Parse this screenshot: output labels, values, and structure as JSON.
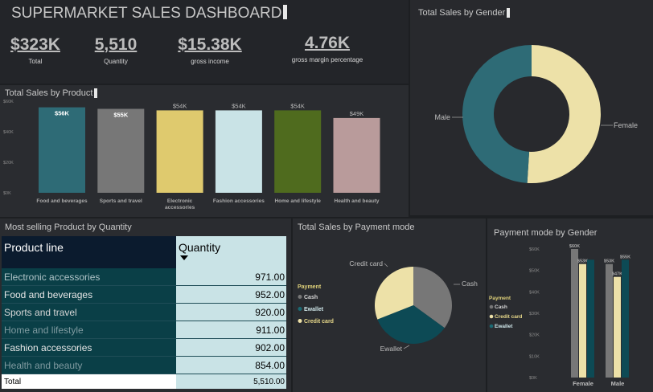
{
  "header": {
    "title": "SUPERMARKET SALES DASHBOARD"
  },
  "kpis": [
    {
      "value": "$323K",
      "label": "Total"
    },
    {
      "value": "5,510",
      "label": "Quantity"
    },
    {
      "value": "$15.38K",
      "label": "gross income"
    },
    {
      "value": "4.76K",
      "label": "gross margin percentage"
    }
  ],
  "colors": {
    "teal_dark": "#0d4a55",
    "teal": "#2e6b76",
    "cream": "#ede1a8",
    "grey": "#777777",
    "yellow": "#dfca6e",
    "light_blue": "#c9e3e6",
    "olive": "#4f6b1e",
    "rose": "#b99b9b"
  },
  "product_chart": {
    "title": "Total Sales by Product",
    "y_ticks": [
      "$0K",
      "$20K",
      "$40K",
      "$60K"
    ]
  },
  "gender_chart": {
    "title": "Total Sales by Gender"
  },
  "table": {
    "title": "Most selling Product by Quantity",
    "col_product": "Product line",
    "col_quantity": "Quantity",
    "rows": [
      {
        "product": "Electronic accessories",
        "qty": "971.00"
      },
      {
        "product": "Food and beverages",
        "qty": "952.00"
      },
      {
        "product": "Sports and travel",
        "qty": "920.00"
      },
      {
        "product": "Home and lifestyle",
        "qty": "911.00"
      },
      {
        "product": "Fashion accessories",
        "qty": "902.00"
      },
      {
        "product": "Health and beauty",
        "qty": "854.00"
      }
    ],
    "total_label": "Total",
    "total_value": "5,510.00"
  },
  "payment_chart": {
    "title": "Total Sales by Payment mode",
    "legend_title": "Payment"
  },
  "paygender_chart": {
    "title": "Payment mode by Gender",
    "legend_title": "Payment",
    "y_ticks": [
      "$0K",
      "$10K",
      "$20K",
      "$30K",
      "$40K",
      "$50K",
      "$60K"
    ]
  },
  "chart_data": [
    {
      "type": "bar",
      "title": "Total Sales by Product",
      "categories": [
        "Food and beverages",
        "Sports and travel",
        "Electronic accessories",
        "Fashion accessories",
        "Home and lifestyle",
        "Health and beauty"
      ],
      "values": [
        56,
        55,
        54,
        54,
        54,
        49
      ],
      "data_labels": [
        "$56K",
        "$55K",
        "$54K",
        "$54K",
        "$54K",
        "$49K"
      ],
      "colors": [
        "#2e6b76",
        "#777777",
        "#dfca6e",
        "#c9e3e6",
        "#4f6b1e",
        "#b99b9b"
      ],
      "ylim": [
        0,
        60
      ],
      "grid": false
    },
    {
      "type": "pie",
      "title": "Total Sales by Gender",
      "labels": [
        "Female",
        "Male"
      ],
      "values": [
        51,
        49
      ],
      "colors": [
        "#ede1a8",
        "#2e6b76"
      ]
    },
    {
      "type": "pie",
      "title": "Total Sales by Payment mode",
      "labels": [
        "Cash",
        "Ewallet",
        "Credit card"
      ],
      "values": [
        35,
        34,
        31
      ],
      "colors": [
        "#777777",
        "#0d4a55",
        "#ede1a8"
      ],
      "legend": "left"
    },
    {
      "type": "bar",
      "title": "Payment mode by Gender",
      "categories": [
        "Female",
        "Male"
      ],
      "series": [
        {
          "name": "Cash",
          "values": [
            60,
            53
          ],
          "labels": [
            "$60K",
            "$53K"
          ]
        },
        {
          "name": "Credit card",
          "values": [
            53,
            47
          ],
          "labels": [
            "$53K",
            "$47K"
          ]
        },
        {
          "name": "Ewallet",
          "values": [
            55,
            55
          ],
          "labels": [
            "",
            "$55K"
          ]
        }
      ],
      "colors": [
        "#777777",
        "#ede1a8",
        "#0d4a55"
      ],
      "ylim": [
        0,
        60
      ],
      "legend": "left"
    }
  ]
}
